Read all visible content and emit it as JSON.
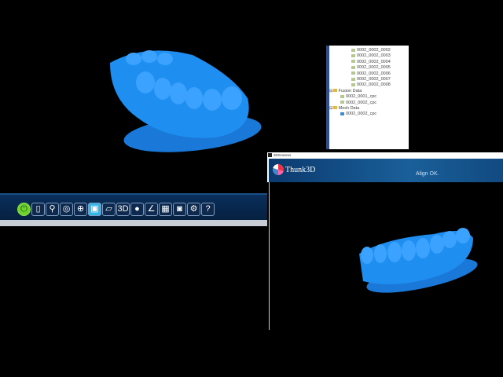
{
  "toolbar": {
    "tools": [
      {
        "name": "power",
        "glyph": "⏻"
      },
      {
        "name": "new-file",
        "glyph": "▯"
      },
      {
        "name": "scanner",
        "glyph": "⚲"
      },
      {
        "name": "calibrate",
        "glyph": "◎"
      },
      {
        "name": "globe",
        "glyph": "⊕"
      },
      {
        "name": "save",
        "glyph": "▣"
      },
      {
        "name": "open-folder",
        "glyph": "▱"
      },
      {
        "name": "3d-view",
        "glyph": "3D"
      },
      {
        "name": "mesh",
        "glyph": "●"
      },
      {
        "name": "align",
        "glyph": "∠"
      },
      {
        "name": "grid",
        "glyph": "▦"
      },
      {
        "name": "camera",
        "glyph": "◙"
      },
      {
        "name": "settings",
        "glyph": "⚙"
      },
      {
        "name": "help",
        "glyph": "?"
      }
    ]
  },
  "tree": {
    "scans": [
      "0002_0002_0002",
      "0002_0002_0003",
      "0002_0002_0004",
      "0002_0002_0005",
      "0002_0002_0006",
      "0002_0002_0007",
      "0002_0002_0008"
    ],
    "fusion_label": "Fusion Data",
    "fusion": [
      "0002_0001_cpc",
      "0002_0002_cpc"
    ],
    "mesh_label": "Mesh Data",
    "mesh": [
      "0002_0002_cpc"
    ]
  },
  "window": {
    "title": "3DScanner",
    "brand": "Thunk3D",
    "status": "Align OK."
  },
  "colors": {
    "model": "#1e8ef0",
    "toolbar": "#0a2f5c"
  }
}
